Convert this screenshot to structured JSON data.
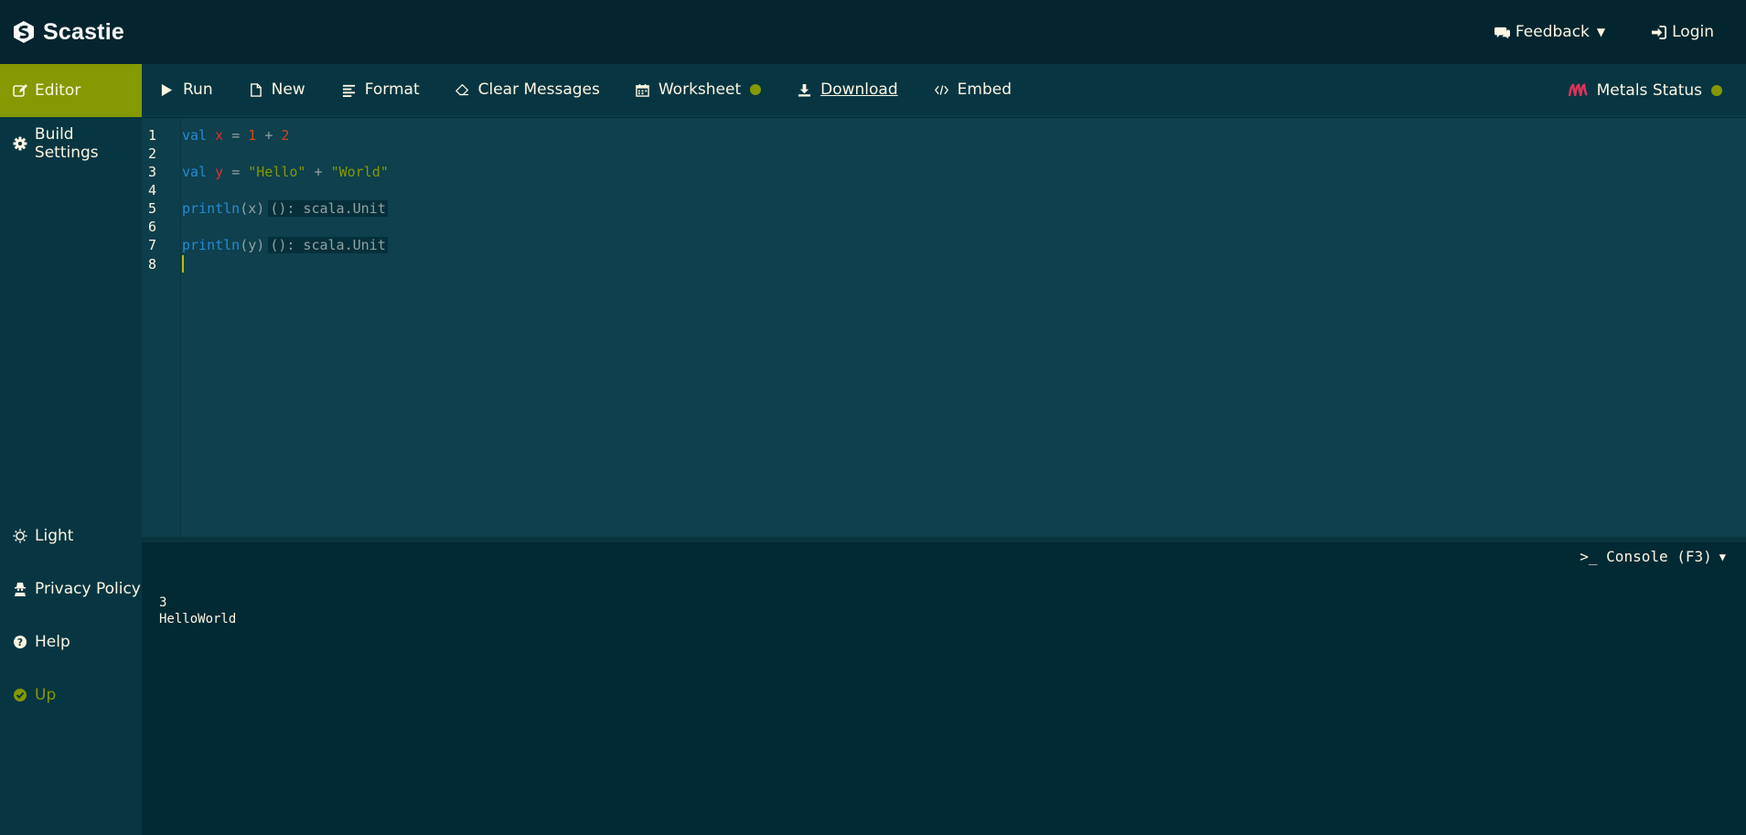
{
  "app": {
    "title": "Scastie"
  },
  "header": {
    "feedback_label": "Feedback",
    "login_label": "Login"
  },
  "sidebar": {
    "items": [
      {
        "label": "Editor",
        "icon": "edit-icon",
        "active": true
      },
      {
        "label": "Build Settings",
        "icon": "gear-icon"
      }
    ],
    "bottom_items": [
      {
        "label": "Light",
        "icon": "sun-icon"
      },
      {
        "label": "Privacy Policy",
        "icon": "user-secret-icon"
      },
      {
        "label": "Help",
        "icon": "question-circle-icon"
      },
      {
        "label": "Up",
        "icon": "check-circle-icon"
      }
    ]
  },
  "toolbar": {
    "run_label": "Run",
    "new_label": "New",
    "format_label": "Format",
    "clear_label": "Clear Messages",
    "worksheet_label": "Worksheet",
    "download_label": "Download",
    "embed_label": "Embed",
    "metals_label": "Metals Status"
  },
  "editor": {
    "line_numbers": [
      "1",
      "2",
      "3",
      "4",
      "5",
      "6",
      "7",
      "8"
    ],
    "inline_result": "(): scala.Unit",
    "lines": [
      {
        "kw": "val",
        "name": "x",
        "eq": "=",
        "a": "1",
        "plus": "+",
        "b": "2"
      },
      {
        "kw": "val",
        "name": "y",
        "eq": "=",
        "a": "\"Hello\"",
        "plus": "+",
        "b": "\"World\""
      },
      {
        "fn": "println",
        "arg": "(x)"
      },
      {
        "fn": "println",
        "arg": "(y)"
      }
    ]
  },
  "console": {
    "header": "Console (F3)",
    "output": [
      "3",
      "HelloWorld"
    ]
  },
  "colors": {
    "accent": "#859900",
    "background": "#002b36",
    "panel": "#073642"
  }
}
